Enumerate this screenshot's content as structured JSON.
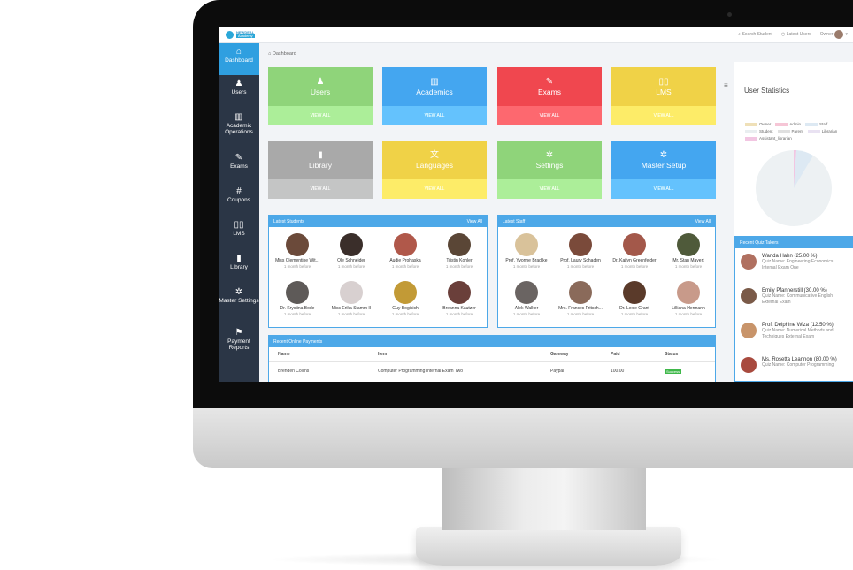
{
  "app": {
    "logo_line1": "NEWDEAL",
    "logo_line2": "Academy"
  },
  "topbar": {
    "search": "Search Student",
    "latest": "Latest Users",
    "user": "Owner"
  },
  "sidebar": [
    {
      "label": "Dashboard",
      "icon": "home-icon"
    },
    {
      "label": "Users",
      "icon": "users-icon"
    },
    {
      "label": "Academic Operations",
      "icon": "bank-icon"
    },
    {
      "label": "Exams",
      "icon": "edit-icon"
    },
    {
      "label": "Coupons",
      "icon": "hash-icon"
    },
    {
      "label": "LMS",
      "icon": "book-open-icon"
    },
    {
      "label": "Library",
      "icon": "book-icon"
    },
    {
      "label": "Master Settings",
      "icon": "gear-icon"
    },
    {
      "label": "Payment Reports",
      "icon": "flag-icon"
    }
  ],
  "breadcrumb": "Dashboard",
  "tiles": [
    {
      "label": "Users",
      "link": "VIEW ALL",
      "color": "#8fd47a",
      "icon": "user-icon"
    },
    {
      "label": "Academics",
      "link": "VIEW ALL",
      "color": "#44a6f0",
      "icon": "bank-icon"
    },
    {
      "label": "Exams",
      "link": "VIEW ALL",
      "color": "#f0474f",
      "icon": "edit-icon"
    },
    {
      "label": "LMS",
      "link": "VIEW ALL",
      "color": "#f0d247",
      "icon": "book-open-icon"
    },
    {
      "label": "Library",
      "link": "VIEW ALL",
      "color": "#a9a9a9",
      "icon": "book-icon"
    },
    {
      "label": "Languages",
      "link": "VIEW ALL",
      "color": "#f0d247",
      "icon": "language-icon"
    },
    {
      "label": "Settings",
      "link": "VIEW ALL",
      "color": "#8fd47a",
      "icon": "gear-icon"
    },
    {
      "label": "Master Setup",
      "link": "VIEW ALL",
      "color": "#44a6f0",
      "icon": "gears-icon"
    }
  ],
  "latest_students": {
    "title": "Latest Students",
    "view": "View All",
    "people": [
      {
        "name": "Miss Clementine Wit...",
        "time": "1 month before",
        "color": "#6b4a3a"
      },
      {
        "name": "Ole Schneider",
        "time": "1 month before",
        "color": "#3a2e2a"
      },
      {
        "name": "Audie Prohaska",
        "time": "1 month before",
        "color": "#b0584a"
      },
      {
        "name": "Tristin Kohler",
        "time": "1 month before",
        "color": "#5a4636"
      },
      {
        "name": "Dr. Krystina Bode",
        "time": "1 month before",
        "color": "#5e5a58"
      },
      {
        "name": "Miss Erika Stamm II",
        "time": "1 month before",
        "color": "#d8d0d0"
      },
      {
        "name": "Guy Bogisich",
        "time": "1 month before",
        "color": "#c29a36"
      },
      {
        "name": "Breanna Kautzer",
        "time": "1 month before",
        "color": "#6a3f3a"
      }
    ]
  },
  "latest_staff": {
    "title": "Latest Staff",
    "view": "View All",
    "people": [
      {
        "name": "Prof. Yvonne Bradtke",
        "time": "1 month before",
        "color": "#d9c29a"
      },
      {
        "name": "Prof. Laury Schaden",
        "time": "1 month before",
        "color": "#7a4a3a"
      },
      {
        "name": "Dr. Kailyn Greenfelder",
        "time": "1 month before",
        "color": "#a3584a"
      },
      {
        "name": "Mr. Stan Mayert",
        "time": "1 month before",
        "color": "#4f5a3a"
      },
      {
        "name": "Alek Walker",
        "time": "1 month before",
        "color": "#6a6462"
      },
      {
        "name": "Mrs. Frances Fritsch...",
        "time": "1 month before",
        "color": "#8a6a5a"
      },
      {
        "name": "Dr. Lexie Grant",
        "time": "1 month before",
        "color": "#5a3a2a"
      },
      {
        "name": "Lilliana Hermann",
        "time": "1 month before",
        "color": "#c89a8a"
      }
    ]
  },
  "payments": {
    "title": "Recent Online Payments",
    "headers": [
      "Name",
      "Item",
      "Gateway",
      "Paid",
      "Status"
    ],
    "rows": [
      [
        "Brenden Collins",
        "Computer Programming Internal Exam Two",
        "Paypal",
        "100.00",
        "Success"
      ]
    ]
  },
  "user_stats": {
    "title": "User Statistics",
    "legend": [
      {
        "label": "Owner",
        "color": "#efe0b8"
      },
      {
        "label": "Admin",
        "color": "#f6c6d6"
      },
      {
        "label": "Staff",
        "color": "#dde9f3"
      },
      {
        "label": "Student",
        "color": "#e9eef0"
      },
      {
        "label": "Parent",
        "color": "#e0e0e0"
      },
      {
        "label": "Librarian",
        "color": "#e9e2f2"
      },
      {
        "label": "Assistant_librarian",
        "color": "#f2c6e2"
      }
    ]
  },
  "quiz": {
    "title": "Recent Quiz Takers",
    "items": [
      {
        "name": "Wanda Hahn (25.00 %)",
        "line1": "Quiz Name: Engineering Economics",
        "line2": "Internal Exam One",
        "color": "#b07060"
      },
      {
        "name": "Emily Pfannerstill (30.00 %)",
        "line1": "Quiz Name: Communicative English",
        "line2": "External Exam",
        "color": "#7a5a48"
      },
      {
        "name": "Prof. Delphine Wiza (12.50 %)",
        "line1": "Quiz Name: Numerical Methods and",
        "line2": "Techniques External Exam",
        "color": "#c8946a"
      },
      {
        "name": "Ms. Rosetta Leannon (80.00 %)",
        "line1": "Quiz Name: Computer Programming",
        "line2": "",
        "color": "#a84a3e"
      }
    ]
  }
}
